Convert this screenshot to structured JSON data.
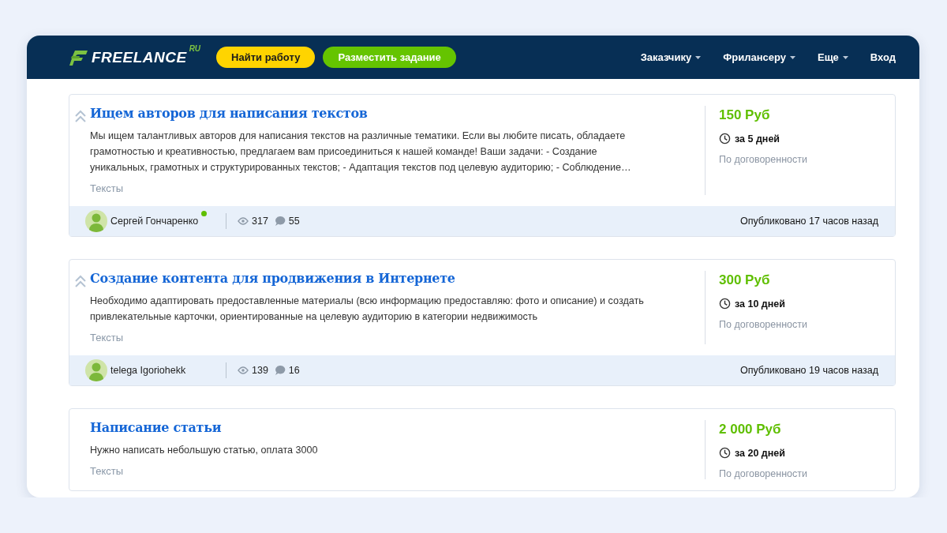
{
  "header": {
    "logo": {
      "name": "FREELANCE",
      "suffix": "RU"
    },
    "buttons": [
      {
        "label": "Найти работу",
        "kind": "yellow"
      },
      {
        "label": "Разместить задание",
        "kind": "green"
      }
    ],
    "nav": [
      {
        "label": "Заказчику",
        "dropdown": true
      },
      {
        "label": "Фрилансеру",
        "dropdown": true
      },
      {
        "label": "Еще",
        "dropdown": true
      },
      {
        "label": "Вход",
        "dropdown": false
      }
    ]
  },
  "jobs": [
    {
      "title": "Ищем авторов для написания текстов",
      "promoted": true,
      "description": "Мы ищем талантливых авторов для написания текстов на различные тематики. Если вы любите писать, обладаете грамотностью и креативностью, предлагаем вам присоединиться к нашей команде! Ваши задачи: - Создание уникальных, грамотных и структурированных текстов; - Адаптация текстов под целевую аудиторию; - Соблюдение…",
      "category": "Тексты",
      "price": "150 Руб",
      "deadline": "за 5 дней",
      "terms": "По договоренности",
      "author": {
        "name": "Сергей Гончаренко",
        "online": true
      },
      "views": "317",
      "comments": "55",
      "published": "Опубликовано 17 часов назад"
    },
    {
      "title": "Создание контента для продвижения в Интернете",
      "promoted": true,
      "description": "Необходимо адаптировать предоставленные материалы (всю информацию предоставляю: фото и описание) и создать привлекательные карточки, ориентированные на целевую аудиторию в категории недвижимость",
      "category": "Тексты",
      "price": "300 Руб",
      "deadline": "за 10 дней",
      "terms": "По договоренности",
      "author": {
        "name": "telega Igoriohekk",
        "online": false
      },
      "views": "139",
      "comments": "16",
      "published": "Опубликовано 19 часов назад"
    },
    {
      "title": "Написание статьи",
      "promoted": false,
      "description": "Нужно написать небольшую статью, оплата 3000",
      "category": "Тексты",
      "price": "2 000 Руб",
      "deadline": "за 20 дней",
      "terms": "По договоренности"
    }
  ]
}
